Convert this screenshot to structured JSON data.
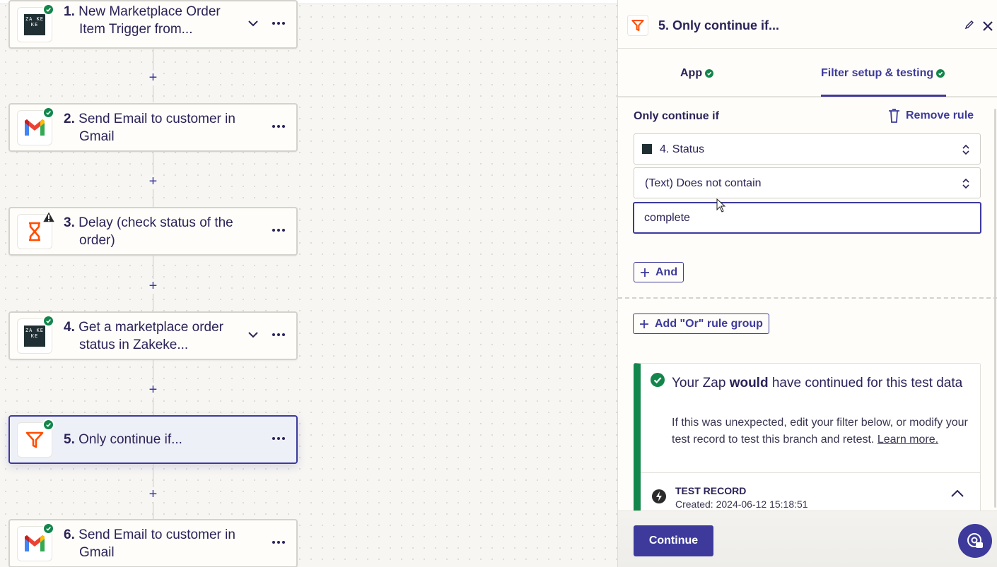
{
  "colors": {
    "accent": "#3d3a9c",
    "success": "#13864b",
    "warning": "#2b2b2b",
    "filter_orange": "#ff4f00"
  },
  "steps": [
    {
      "number": "1.",
      "line1": "New Marketplace Order",
      "line2": "Item Trigger from...",
      "app": "Zakeke",
      "app_logo_text": "ZA KE KE",
      "status": "ok",
      "has_chevron": true
    },
    {
      "number": "2.",
      "line1": "Send Email to customer in",
      "line2": "Gmail",
      "app": "Gmail",
      "status": "ok",
      "has_chevron": false
    },
    {
      "number": "3.",
      "line1": "Delay (check status of the",
      "line2": "order)",
      "app": "Delay",
      "status": "warning",
      "has_chevron": false
    },
    {
      "number": "4.",
      "line1": "Get a marketplace order",
      "line2": "status in Zakeke...",
      "app": "Zakeke",
      "app_logo_text": "ZA KE KE",
      "status": "ok",
      "has_chevron": true
    },
    {
      "number": "5.",
      "line1": "Only continue if...",
      "line2": "",
      "app": "Filter",
      "status": "ok",
      "has_chevron": false,
      "selected": true
    },
    {
      "number": "6.",
      "line1": "Send Email to customer in",
      "line2": "Gmail",
      "app": "Gmail",
      "status": "ok",
      "has_chevron": false
    }
  ],
  "add_step_symbol": "+",
  "panel": {
    "title": "5. Only continue if...",
    "tabs": [
      {
        "label": "App",
        "status": "ok"
      },
      {
        "label": "Filter setup & testing",
        "status": "ok",
        "active": true
      }
    ],
    "rule_label": "Only continue if",
    "remove_rule_label": "Remove rule",
    "field_select": "4. Status",
    "condition_select": "(Text) Does not contain",
    "value_input": "complete",
    "and_button": "And",
    "or_group_button": "Add \"Or\" rule group",
    "result": {
      "headline_pre": "Your Zap ",
      "headline_bold": "would",
      "headline_post": " have continued for this test data",
      "body": "If this was unexpected, edit your filter below, or modify your test record to test this branch and retest. ",
      "learn_more": "Learn more."
    },
    "test_record": {
      "title": "TEST RECORD",
      "created": "Created: 2024-06-12 15:18:51"
    },
    "continue_button": "Continue"
  }
}
